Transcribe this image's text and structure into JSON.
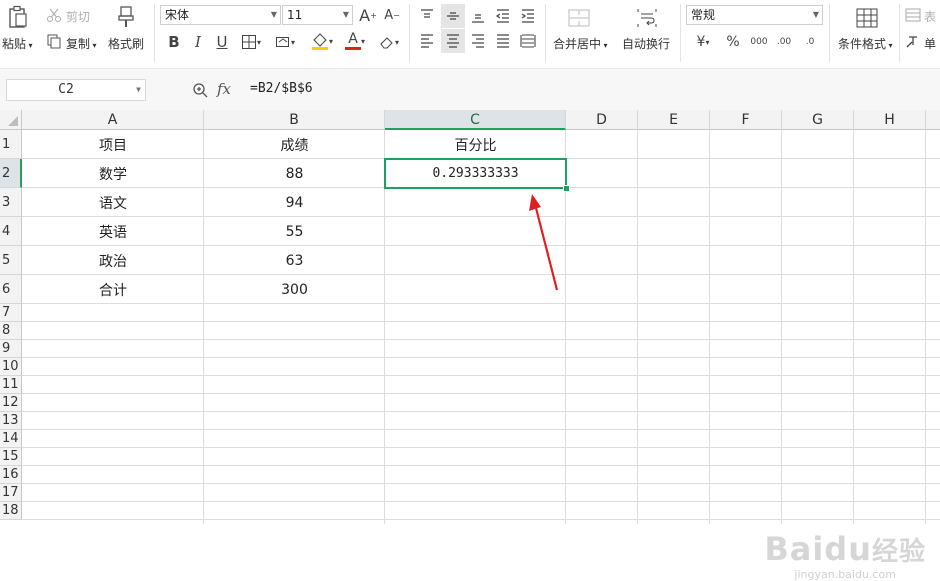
{
  "ribbon": {
    "paste": "粘贴",
    "cut": "剪切",
    "copy": "复制",
    "format_painter": "格式刷",
    "font_name": "宋体",
    "font_size": "11",
    "merge_center": "合并居中",
    "wrap_text": "自动换行",
    "number_format": "常规",
    "percent_symbol": "%",
    "thousands_sep": "000",
    "increase_decimal": ".00",
    "decrease_decimal": ".0",
    "conditional_format": "条件格式",
    "table_style": "表",
    "cell_style": "单",
    "bold": "B",
    "italic": "I",
    "underline": "U",
    "font_color_glyph": "A",
    "increase_font_glyph": "A",
    "decrease_font_glyph": "A",
    "currency_glyph": "¥"
  },
  "formula_bar": {
    "cell_ref": "C2",
    "fx_label": "fx",
    "formula": "=B2/$B$6"
  },
  "sheet": {
    "columns": [
      "A",
      "B",
      "C",
      "D",
      "E",
      "F",
      "G",
      "H"
    ],
    "rows": [
      "1",
      "2",
      "3",
      "4",
      "5",
      "6",
      "7",
      "8",
      "9",
      "10",
      "11",
      "12",
      "13",
      "14",
      "15",
      "16",
      "17",
      "18"
    ],
    "cells": {
      "A1": "项目",
      "B1": "成绩",
      "C1": "百分比",
      "A2": "数学",
      "B2": "88",
      "C2": "0.293333333",
      "A3": "语文",
      "B3": "94",
      "A4": "英语",
      "B4": "55",
      "A5": "政治",
      "B5": "63",
      "A6": "合计",
      "B6": "300"
    },
    "selected_cell": "C2"
  },
  "watermark": {
    "brand": "Baidu",
    "brand_cn": "经验",
    "url": "jingyan.baidu.com"
  },
  "colors": {
    "selection": "#1aa260",
    "arrow": "#e02020"
  }
}
